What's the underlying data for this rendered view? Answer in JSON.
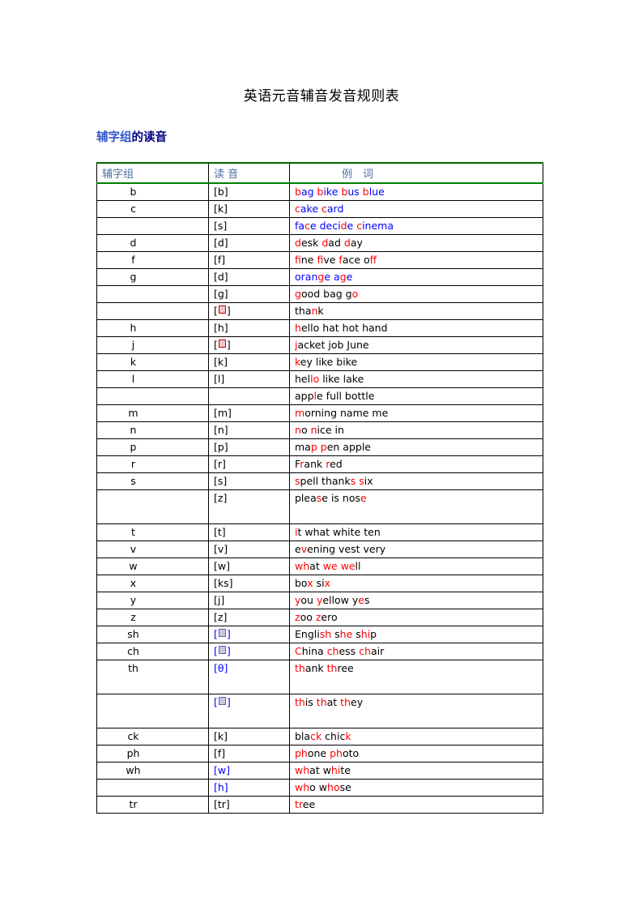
{
  "document": {
    "title": "英语元音辅音发音规则表",
    "section_heading": {
      "part_a": "辅字组",
      "part_b": "的读音"
    }
  },
  "table": {
    "columns": [
      {
        "key": "letter",
        "header": "辅字组"
      },
      {
        "key": "sound",
        "header": "读 音"
      },
      {
        "key": "words",
        "header": "例　词"
      }
    ],
    "header_color": "#4a6fa5",
    "header_rule_color": "#008000",
    "rows": [
      {
        "letter": "b",
        "sound": "[b]",
        "words": "bag bike bus blue",
        "sound_color": "#000000",
        "tall": false
      },
      {
        "letter": "c",
        "sound": "[k]",
        "words": "cake  card",
        "sound_color": "#000000",
        "tall": false
      },
      {
        "letter": "",
        "sound": "[s]",
        "words": "face decide cinema",
        "sound_color": "#000000",
        "tall": false
      },
      {
        "letter": "d",
        "sound": "[d]",
        "words": "desk dad day",
        "sound_color": "#000000",
        "tall": false
      },
      {
        "letter": "f",
        "sound": "[f]",
        "words": "fine five face off",
        "sound_color": "#000000",
        "tall": false
      },
      {
        "letter": "g",
        "sound": "[d]",
        "words": "orange age",
        "sound_color": "#000000",
        "tall": false
      },
      {
        "letter": "",
        "sound": "[g]",
        "words": "good bag go",
        "sound_color": "#000000",
        "tall": false
      },
      {
        "letter": "",
        "sound": "[ ]",
        "words": "thank",
        "sound_color": "#000000",
        "tall": false
      },
      {
        "letter": "h",
        "sound": "[h]",
        "words": "hello hat hot hand",
        "sound_color": "#000000",
        "tall": false
      },
      {
        "letter": "j",
        "sound": "[ ]",
        "words": "jacket job June",
        "sound_color": "#000000",
        "tall": false
      },
      {
        "letter": "k",
        "sound": "[k]",
        "words": "key like bike",
        "sound_color": "#000000",
        "tall": false
      },
      {
        "letter": "l",
        "sound": "[l]",
        "words": "hello like lake",
        "sound_color": "#000000",
        "tall": false
      },
      {
        "letter": "",
        "sound": "",
        "words": "apple full bottle",
        "sound_color": "#000000",
        "tall": false
      },
      {
        "letter": "m",
        "sound": "[m]",
        "words": "morning name me",
        "sound_color": "#000000",
        "tall": false
      },
      {
        "letter": "n",
        "sound": "[n]",
        "words": "no nice in",
        "sound_color": "#000000",
        "tall": false
      },
      {
        "letter": "p",
        "sound": "[p]",
        "words": "map pen apple",
        "sound_color": "#000000",
        "tall": false
      },
      {
        "letter": "r",
        "sound": "[r]",
        "words": "Frank red",
        "sound_color": "#000000",
        "tall": false
      },
      {
        "letter": "s",
        "sound": "[s]",
        "words": "spell thanks  six",
        "sound_color": "#000000",
        "tall": false
      },
      {
        "letter": "",
        "sound": "[z]",
        "words": "please is nose",
        "sound_color": "#000000",
        "tall": true
      },
      {
        "letter": "t",
        "sound": "[t]",
        "words": "it what white ten",
        "sound_color": "#000000",
        "tall": false
      },
      {
        "letter": "v",
        "sound": "[v]",
        "words": "evening vest very",
        "sound_color": "#000000",
        "tall": false
      },
      {
        "letter": "w",
        "sound": "[w]",
        "words": "what we well",
        "sound_color": "#000000",
        "tall": false
      },
      {
        "letter": "x",
        "sound": "[ks]",
        "words": "box six",
        "sound_color": "#000000",
        "tall": false
      },
      {
        "letter": "y",
        "sound": "[j]",
        "words": "you yellow yes",
        "sound_color": "#000000",
        "tall": false
      },
      {
        "letter": "z",
        "sound": "[z]",
        "words": "zoo zero",
        "sound_color": "#000000",
        "tall": false
      },
      {
        "letter": "sh",
        "sound": "[ ]",
        "words": "English she ship",
        "sound_color": "#0000ff",
        "tall": false
      },
      {
        "letter": "ch",
        "sound": "[ ]",
        "words": "China chess chair",
        "sound_color": "#0000ff",
        "tall": false
      },
      {
        "letter": "th",
        "sound": "[θ]",
        "words": "thank three",
        "sound_color": "#0000ff",
        "tall": true
      },
      {
        "letter": "",
        "sound": "[ ]",
        "words": "this that they",
        "sound_color": "#0000ff",
        "tall": true
      },
      {
        "letter": "ck",
        "sound": "[k]",
        "words": "black chick",
        "sound_color": "#000000",
        "tall": false
      },
      {
        "letter": "ph",
        "sound": "[f]",
        "words": "phone photo",
        "sound_color": "#000000",
        "tall": false
      },
      {
        "letter": "wh",
        "sound": "[w]",
        "words": "what white",
        "sound_color": "#0000ff",
        "tall": false
      },
      {
        "letter": "",
        "sound": "[h]",
        "words": "who whose",
        "sound_color": "#0000ff",
        "tall": false
      },
      {
        "letter": "tr",
        "sound": "[tr]",
        "words": "tree",
        "sound_color": "#000000",
        "tall": false
      }
    ]
  },
  "colors": {
    "highlight": "#ff0000",
    "base_black": "#000000",
    "base_blue": "#0000ff",
    "header_text": "#4a6fa5",
    "heading_light_blue": "#3355cc",
    "heading_navy": "#000080",
    "table_rule_green": "#008000"
  }
}
